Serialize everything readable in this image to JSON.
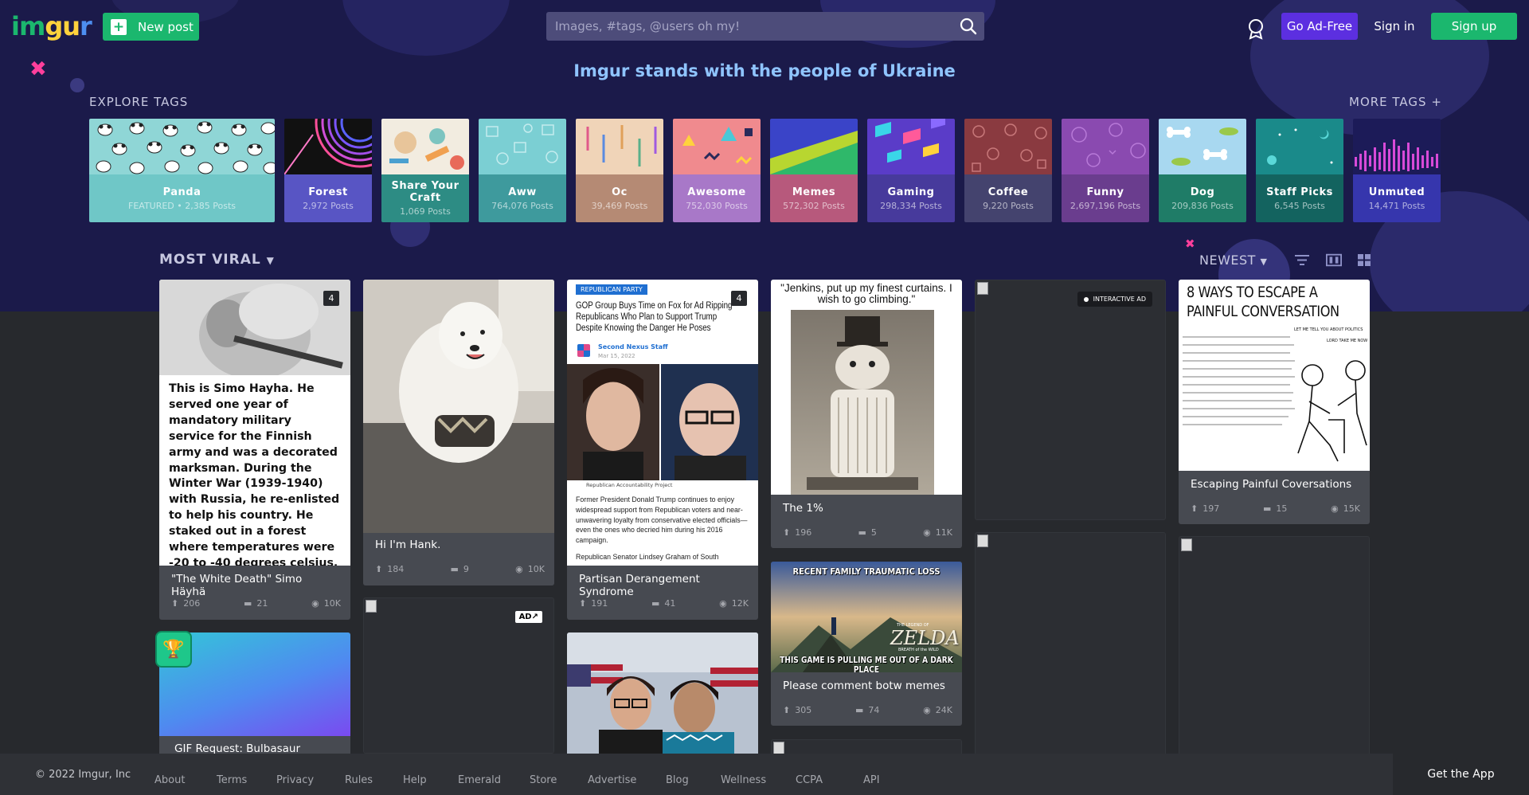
{
  "header": {
    "logo": "imgur",
    "new_post": "New post",
    "search_placeholder": "Images, #tags, @users oh my!",
    "go_ad_free": "Go Ad-Free",
    "sign_in": "Sign in",
    "sign_up": "Sign up"
  },
  "banner": "Imgur stands with the people of Ukraine",
  "explore": {
    "heading": "EXPLORE TAGS",
    "more": "MORE TAGS +",
    "tags": [
      {
        "name": "Panda",
        "count": "FEATURED • 2,385 Posts",
        "color": "#6fc7c7"
      },
      {
        "name": "Forest",
        "count": "2,972 Posts",
        "color": "#5855c4"
      },
      {
        "name": "Share Your Craft",
        "count": "1,069 Posts",
        "color": "#2d8c84"
      },
      {
        "name": "Aww",
        "count": "764,076 Posts",
        "color": "#3e9a9d"
      },
      {
        "name": "Oc",
        "count": "39,469 Posts",
        "color": "#b58a74"
      },
      {
        "name": "Awesome",
        "count": "752,030 Posts",
        "color": "#a878c8"
      },
      {
        "name": "Memes",
        "count": "572,302 Posts",
        "color": "#b7597c"
      },
      {
        "name": "Gaming",
        "count": "298,334 Posts",
        "color": "#473a9c"
      },
      {
        "name": "Coffee",
        "count": "9,220 Posts",
        "color": "#44436e"
      },
      {
        "name": "Funny",
        "count": "2,697,196 Posts",
        "color": "#6a3d8e"
      },
      {
        "name": "Dog",
        "count": "209,836 Posts",
        "color": "#1f7c67"
      },
      {
        "name": "Staff Picks",
        "count": "6,545 Posts",
        "color": "#13635f"
      },
      {
        "name": "Unmuted",
        "count": "14,471 Posts",
        "color": "#3636ad"
      }
    ]
  },
  "feed": {
    "section": "MOST VIRAL",
    "sort": "NEWEST"
  },
  "posts": [
    {
      "title": "\"The White Death\" Simo Häyhä",
      "ups": "206",
      "comments": "21",
      "views": "10K",
      "album_count": "4",
      "text": "This is Simo Hayha. He served one year of mandatory military service for the Finnish army and was a decorated marksman. During the Winter War (1939-1940) with Russia, he re-enlisted to help his country. He staked out in a forest where temperatures were -20 to -40 degrees celsius. He began picking off Russian soldiers. Once they found out all their"
    },
    {
      "title": "Hi I'm Hank.",
      "ups": "184",
      "comments": "9",
      "views": "10K"
    },
    {
      "title": "Partisan Derangement Syndrome",
      "ups": "191",
      "comments": "41",
      "views": "12K",
      "album_count": "4",
      "party": "REPUBLICAN PARTY",
      "headline": "GOP Group Buys Time on Fox for Ad Ripping Republicans Who Plan to Support Trump Despite Knowing the Danger He Poses",
      "source": "Second Nexus Staff",
      "date": "Mar 15, 2022",
      "caption": "Republican Accountability Project",
      "body": "Former President Donald Trump continues to enjoy widespread support from Republican voters and near-unwavering loyalty from conservative elected officials—even the ones who decried him during his 2016 campaign.",
      "body2": "Republican Senator Lindsey Graham of South"
    },
    {
      "title": "The 1%",
      "ups": "196",
      "comments": "5",
      "views": "11K",
      "caption": "\"Jenkins, put up my finest curtains. I wish to go climbing.\""
    },
    {
      "title": "Escaping Painful Coversations",
      "ups": "197",
      "comments": "15",
      "views": "15K",
      "comic_title": "8 WAYS TO ESCAPE A PAINFUL CONVERSATION",
      "comic_speech": "LET ME TELL YOU ABOUT POLITICS",
      "comic_speech2": "LORD TAKE ME NOW"
    },
    {
      "title": "Please comment botw memes",
      "ups": "305",
      "comments": "74",
      "views": "24K",
      "meme_top": "RECENT FAMILY TRAUMATIC LOSS",
      "meme_bottom": "THIS GAME IS PULLING ME OUT OF A DARK PLACE",
      "meme_logo": "ZELDA",
      "meme_logo_small": "THE LEGEND OF",
      "meme_logo_sub": "BREATH of the WILD"
    },
    {
      "title": "GIF Request: Bulbasaur Upvote!"
    }
  ],
  "ads": {
    "interactive": "INTERACTIVE AD",
    "ad_label": "AD"
  },
  "footer": {
    "copyright": "© 2022 Imgur, Inc",
    "links": [
      "About",
      "Terms",
      "Privacy",
      "Rules",
      "Help",
      "Emerald",
      "Store",
      "Advertise",
      "Blog",
      "Wellness",
      "CCPA",
      "API"
    ],
    "get_app": "Get the App"
  },
  "colors": {
    "brand_green": "#1bb76e",
    "ad_free_purple": "#5c2fe0",
    "hero_bg": "#1b1a4a",
    "page_bg": "#27292d"
  }
}
